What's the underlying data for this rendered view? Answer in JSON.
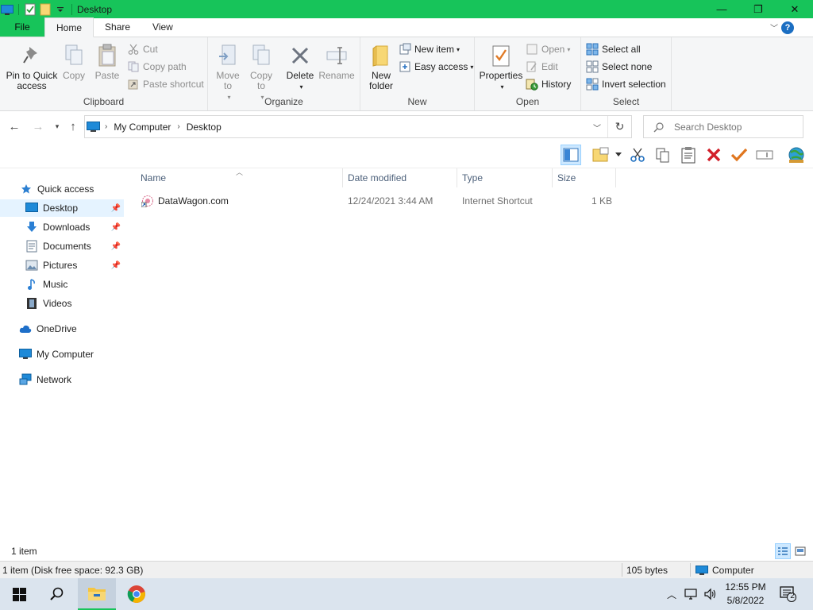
{
  "window": {
    "title": "Desktop",
    "controls": {
      "minimize": "—",
      "maximize": "❐",
      "close": "✕"
    }
  },
  "ribbon_tabs": {
    "file": "File",
    "home": "Home",
    "share": "Share",
    "view": "View"
  },
  "ribbon": {
    "clipboard": {
      "label": "Clipboard",
      "pin": "Pin to Quick access",
      "copy": "Copy",
      "paste": "Paste",
      "cut": "Cut",
      "copy_path": "Copy path",
      "paste_shortcut": "Paste shortcut"
    },
    "organize": {
      "label": "Organize",
      "move_to": "Move to",
      "copy_to": "Copy to",
      "delete": "Delete",
      "rename": "Rename"
    },
    "new": {
      "label": "New",
      "new_folder": "New folder",
      "new_item": "New item",
      "easy_access": "Easy access"
    },
    "open": {
      "label": "Open",
      "properties": "Properties",
      "open": "Open",
      "edit": "Edit",
      "history": "History"
    },
    "select": {
      "label": "Select",
      "select_all": "Select all",
      "select_none": "Select none",
      "invert": "Invert selection"
    }
  },
  "address": {
    "crumbs": [
      "My Computer",
      "Desktop"
    ],
    "search_placeholder": "Search Desktop"
  },
  "nav_pane": {
    "quick_access": "Quick access",
    "items": [
      {
        "label": "Desktop",
        "pinned": true,
        "selected": true
      },
      {
        "label": "Downloads",
        "pinned": true
      },
      {
        "label": "Documents",
        "pinned": true
      },
      {
        "label": "Pictures",
        "pinned": true
      },
      {
        "label": "Music"
      },
      {
        "label": "Videos"
      }
    ],
    "onedrive": "OneDrive",
    "my_computer": "My Computer",
    "network": "Network"
  },
  "columns": {
    "name": "Name",
    "date_modified": "Date modified",
    "type": "Type",
    "size": "Size"
  },
  "files": [
    {
      "name": "DataWagon.com",
      "date_modified": "12/24/2021 3:44 AM",
      "type": "Internet Shortcut",
      "size": "1 KB"
    }
  ],
  "status": {
    "item_count": "1 item",
    "info": "1 item (Disk free space: 92.3 GB)",
    "bytes": "105 bytes",
    "location": "Computer"
  },
  "taskbar": {
    "time": "12:55 PM",
    "date": "5/8/2022",
    "notification_count": "2"
  },
  "colors": {
    "accent": "#17c45a",
    "selection": "#e5f3ff",
    "header_text": "#4c607a"
  }
}
